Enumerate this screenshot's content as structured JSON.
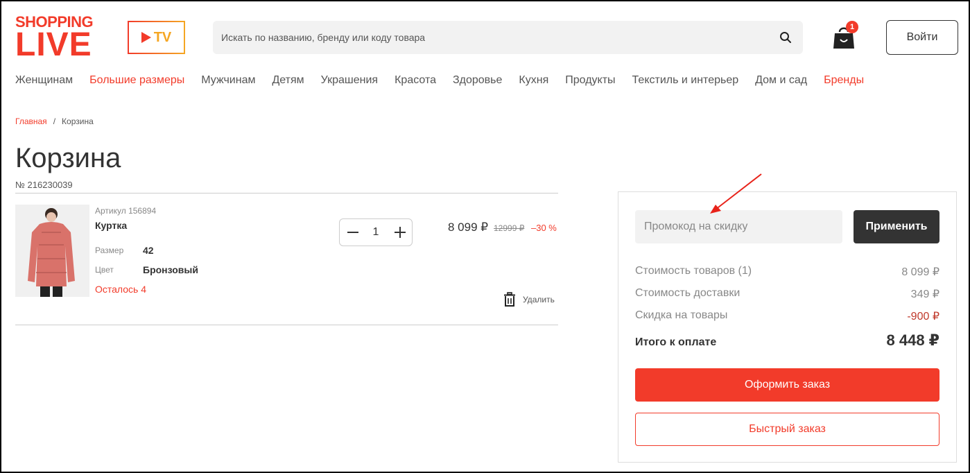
{
  "header": {
    "logo_line1": "SHOPPING",
    "logo_line2": "LIVE",
    "tv_label": "TV",
    "search_placeholder": "Искать по названию, бренду или коду товара",
    "cart_count": "1",
    "login_label": "Войти"
  },
  "nav": [
    {
      "label": "Женщинам",
      "highlight": false
    },
    {
      "label": "Большие размеры",
      "highlight": true
    },
    {
      "label": "Мужчинам",
      "highlight": false
    },
    {
      "label": "Детям",
      "highlight": false
    },
    {
      "label": "Украшения",
      "highlight": false
    },
    {
      "label": "Красота",
      "highlight": false
    },
    {
      "label": "Здоровье",
      "highlight": false
    },
    {
      "label": "Кухня",
      "highlight": false
    },
    {
      "label": "Продукты",
      "highlight": false
    },
    {
      "label": "Текстиль и интерьер",
      "highlight": false
    },
    {
      "label": "Дом и сад",
      "highlight": false
    },
    {
      "label": "Бренды",
      "highlight": true
    }
  ],
  "breadcrumb": {
    "home": "Главная",
    "separator": "/",
    "current": "Корзина"
  },
  "page": {
    "title": "Корзина",
    "order_number": "№ 216230039"
  },
  "item": {
    "article": "Артикул 156894",
    "name": "Куртка",
    "size_label": "Размер",
    "size_value": "42",
    "color_label": "Цвет",
    "color_value": "Бронзовый",
    "stock": "Осталось 4",
    "quantity": "1",
    "price": "8 099 ₽",
    "old_price": "12999 ₽",
    "discount": "–30 %",
    "delete_label": "Удалить"
  },
  "summary": {
    "promo_placeholder": "Промокод на скидку",
    "apply_label": "Применить",
    "rows": [
      {
        "label": "Стоимость товаров (1)",
        "value": "8 099 ₽"
      },
      {
        "label": "Стоимость доставки",
        "value": "349 ₽"
      },
      {
        "label": "Скидка на товары",
        "value": "-900 ₽"
      }
    ],
    "total_label": "Итого к оплате",
    "total_value": "8 448 ₽",
    "checkout_label": "Оформить заказ",
    "quick_order_label": "Быстрый заказ"
  },
  "colors": {
    "accent": "#f23b2a",
    "dark_button": "#333333",
    "tv_border": "#f5a623"
  }
}
